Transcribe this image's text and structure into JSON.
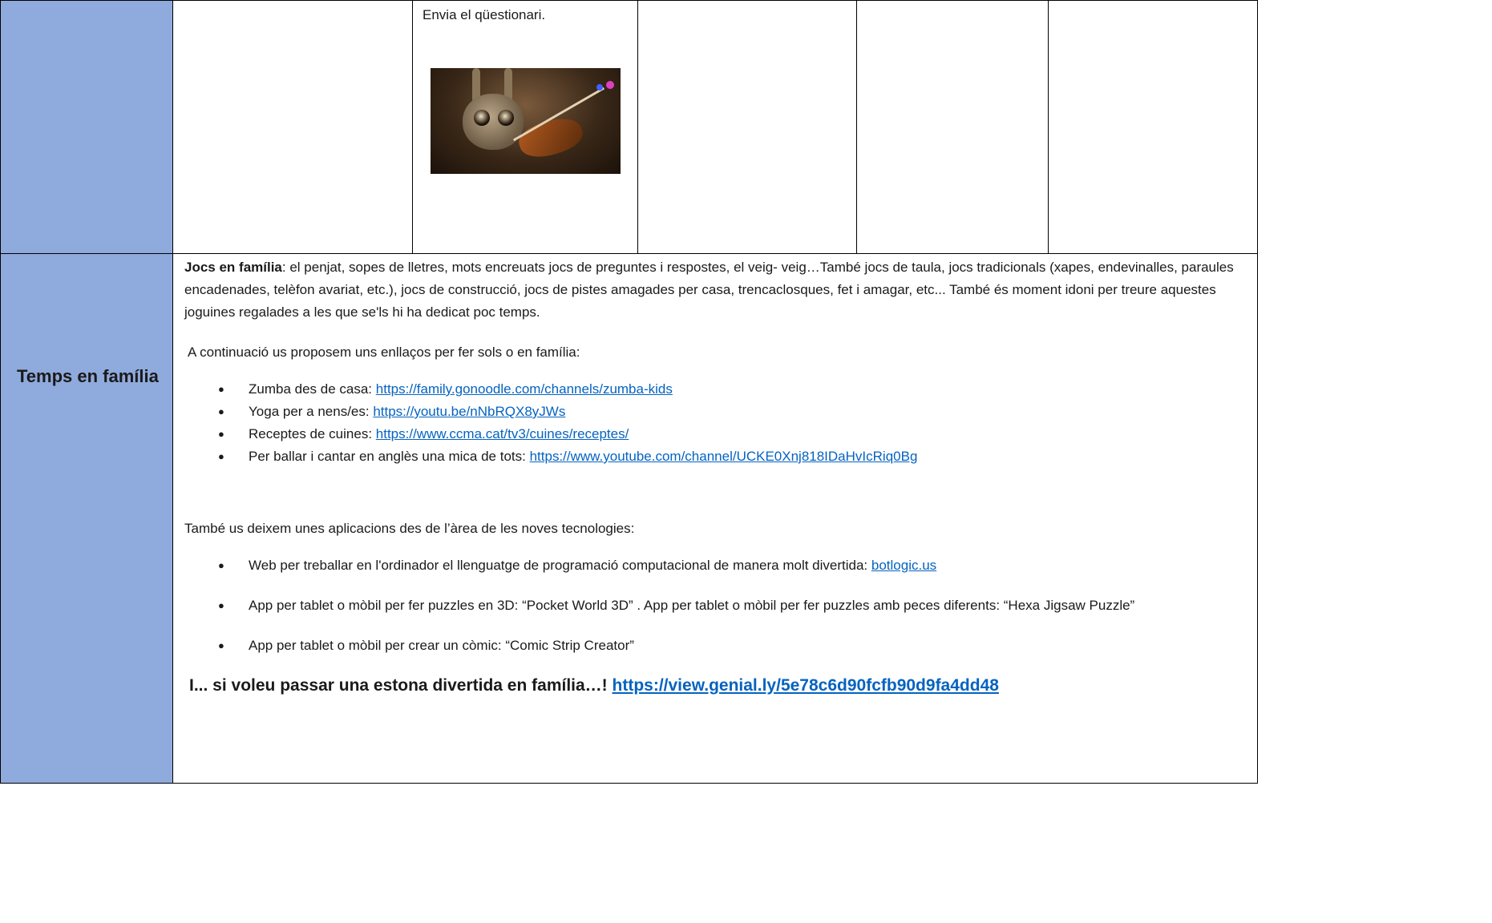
{
  "row_top": {
    "col3_text": "Envia el qüestionari."
  },
  "photo": {
    "subject": "character-playing-violin"
  },
  "row_family": {
    "label": "Temps en família",
    "games_lead": "Jocs en família",
    "games_text": ": el penjat, sopes de lletres, mots encreuats  jocs de preguntes i respostes, el veig- veig…També jocs de taula, jocs tradicionals (xapes, endevinalles, paraules encadenades, telèfon avariat, etc.), jocs de construcció, jocs de pistes amagades per casa, trencaclosques, fet i amagar, etc... També és moment idoni per treure aquestes joguines regalades a les que se'ls hi ha dedicat poc temps.",
    "intro": "A continuació us proposem uns enllaços per fer sols o en família:",
    "links": [
      {
        "label": "Zumba des de casa: ",
        "url": "https://family.gonoodle.com/channels/zumba-kids"
      },
      {
        "label": "Yoga per a nens/es: ",
        "url": "https://youtu.be/nNbRQX8yJWs"
      },
      {
        "label": "Receptes de cuines: ",
        "url": "https://www.ccma.cat/tv3/cuines/receptes/"
      },
      {
        "label": "Per ballar i cantar en anglès una mica de tots: ",
        "url": "https://www.youtube.com/channel/UCKE0Xnj818IDaHvIcRiq0Bg"
      }
    ],
    "tech_intro": "També us deixem unes aplicacions des de l’àrea de les noves tecnologies:",
    "apps": [
      {
        "text": "Web per treballar en l'ordinador el llenguatge de programació computacional de manera molt divertida: ",
        "link": "botlogic.us"
      },
      {
        "text": "App per tablet o mòbil per fer puzzles en 3D: “Pocket World 3D” . App per tablet o mòbil per fer puzzles amb peces diferents: “Hexa Jigsaw Puzzle”",
        "link": ""
      },
      {
        "text": "App per tablet o mòbil per crear un còmic: “Comic Strip Creator”",
        "link": ""
      }
    ],
    "final_text": "I... si voleu passar una estona divertida en família…! ",
    "final_url": "https://view.genial.ly/5e78c6d90fcfb90d9fa4dd48"
  },
  "colors": {
    "label_bg": "#8faadc",
    "link": "#0563c1"
  }
}
